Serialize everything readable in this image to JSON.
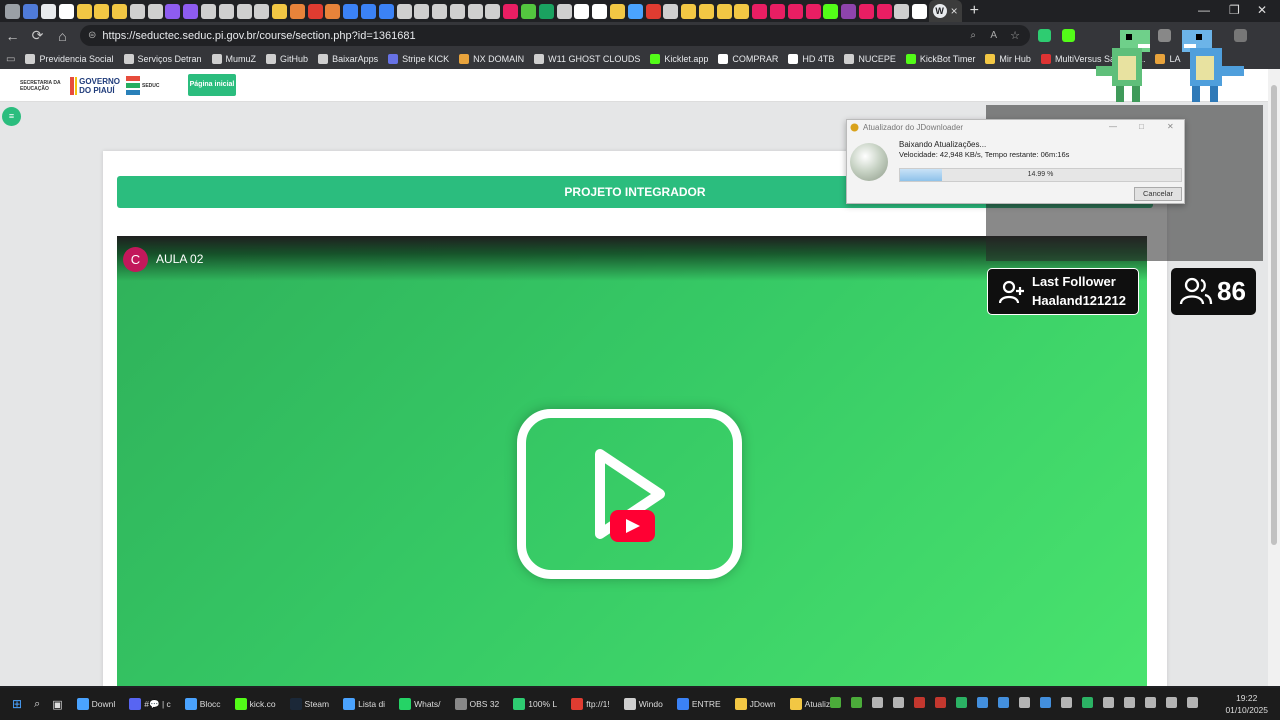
{
  "browser": {
    "url": "https://seductec.seduc.pi.gov.br/course/section.php?id=1361681",
    "active_tab_close": "×",
    "new_tab": "+",
    "window_controls": {
      "minimize": "—",
      "maximize": "❐",
      "close": "✕"
    }
  },
  "bookmarks": [
    {
      "label": "Previdencia Social",
      "color": "#cfcfcf"
    },
    {
      "label": "Serviços Detran",
      "color": "#cfcfcf"
    },
    {
      "label": "MumuZ",
      "color": "#cfcfcf"
    },
    {
      "label": "GitHub",
      "color": "#cfcfcf"
    },
    {
      "label": "BaixarApps",
      "color": "#cfcfcf"
    },
    {
      "label": "Stripe KICK",
      "color": "#6772e5"
    },
    {
      "label": "NX DOMAIN",
      "color": "#e8a33c"
    },
    {
      "label": "W11 GHOST CLOUDS",
      "color": "#cfcfcf"
    },
    {
      "label": "Kicklet.app",
      "color": "#53fc18"
    },
    {
      "label": "COMPRAR",
      "color": "#ffffff"
    },
    {
      "label": "HD 4TB",
      "color": "#ffffff"
    },
    {
      "label": "NUCEPE",
      "color": "#cfcfcf"
    },
    {
      "label": "KickBot Timer",
      "color": "#53fc18"
    },
    {
      "label": "Mir Hub",
      "color": "#f2c744"
    },
    {
      "label": "MultiVersus Save Ed...",
      "color": "#d33"
    },
    {
      "label": "LA",
      "color": "#e8a33c"
    }
  ],
  "page": {
    "home_button": "Página inicial",
    "menu_toggle": "≡",
    "logos": [
      "SECRETARIA DA EDUCAÇÃO",
      "GOVERNO DO PIAUÍ",
      "SEDUC"
    ],
    "section_title": "PROJETO INTEGRADOR",
    "video": {
      "channel_initial": "C",
      "title": "AULA 02"
    }
  },
  "jdownloader": {
    "title": "Atualizador do JDownloader",
    "status": "Baixando Atualizações...",
    "speed_line": "Velocidade: 42,948 KB/s, Tempo restante: 06m:16s",
    "progress_label": "14.99 %",
    "progress_value": 14.99,
    "cancel_label": "Cancelar"
  },
  "overlay": {
    "last_follower_label": "Last Follower",
    "last_follower_name": "Haaland121212",
    "follower_count": "86"
  },
  "taskbar": {
    "items": [
      "Downl",
      "#💬 | c",
      "Blocc",
      "kick.co",
      "Steam",
      "Lista di",
      "Whats/",
      "OBS 32",
      "100% L",
      "ftp://1!",
      "Windo",
      "ENTRE",
      "JDown",
      "Atualiz"
    ],
    "time": "19:22",
    "date": "01/10/2025"
  },
  "colors": {
    "accent_green": "#2bbd7e",
    "youtube_red": "#ff0033",
    "video_green": "#3dd36a"
  }
}
